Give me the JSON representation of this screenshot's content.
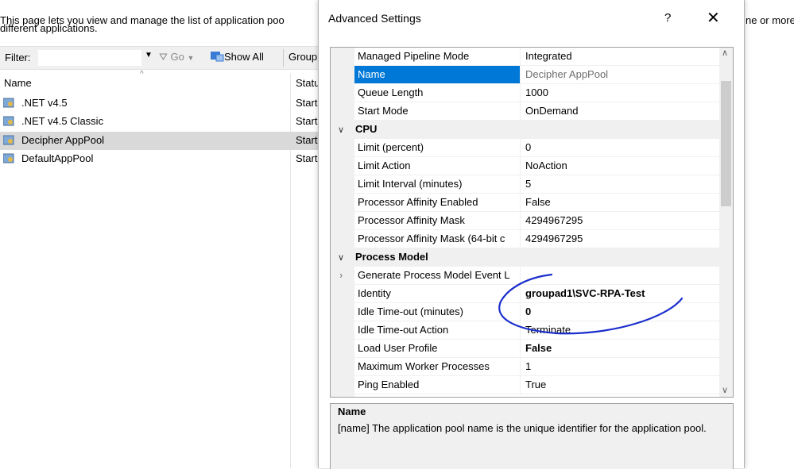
{
  "background": {
    "intro_line1": "This page lets you view and manage the list of application poo",
    "intro_line1_tail": "ne or more",
    "intro_line2": "different applications.",
    "filter_label": "Filter:",
    "go_label": "Go",
    "show_all_label": "Show All",
    "group_label": "Group",
    "col_name": "Name",
    "col_status": "Statu",
    "pools": [
      {
        "name": ".NET v4.5",
        "status": "Start"
      },
      {
        "name": ".NET v4.5 Classic",
        "status": "Start"
      },
      {
        "name": "Decipher AppPool",
        "status": "Start"
      },
      {
        "name": "DefaultAppPool",
        "status": "Start"
      }
    ]
  },
  "dialog": {
    "title": "Advanced Settings",
    "help": "?",
    "close": "✕",
    "properties": [
      {
        "name": "Managed Pipeline Mode",
        "value": "Integrated"
      },
      {
        "name": "Name",
        "value": "Decipher AppPool"
      },
      {
        "name": "Queue Length",
        "value": "1000"
      },
      {
        "name": "Start Mode",
        "value": "OnDemand"
      },
      {
        "category": "CPU"
      },
      {
        "name": "Limit (percent)",
        "value": "0"
      },
      {
        "name": "Limit Action",
        "value": "NoAction"
      },
      {
        "name": "Limit Interval (minutes)",
        "value": "5"
      },
      {
        "name": "Processor Affinity Enabled",
        "value": "False"
      },
      {
        "name": "Processor Affinity Mask",
        "value": "4294967295"
      },
      {
        "name": "Processor Affinity Mask (64-bit c",
        "value": "4294967295"
      },
      {
        "category": "Process Model"
      },
      {
        "name": "Generate Process Model Event L",
        "value": ""
      },
      {
        "name": "Identity",
        "value": "groupad1\\SVC-RPA-Test"
      },
      {
        "name": "Idle Time-out (minutes)",
        "value": "0"
      },
      {
        "name": "Idle Time-out Action",
        "value": "Terminate"
      },
      {
        "name": "Load User Profile",
        "value": "False"
      },
      {
        "name": "Maximum Worker Processes",
        "value": "1"
      },
      {
        "name": "Ping Enabled",
        "value": "True"
      }
    ],
    "description_title": "Name",
    "description_text": "[name] The application pool name is the unique identifier for the application pool."
  },
  "colors": {
    "selection": "#0078d7",
    "annotation": "#1a2ecc"
  }
}
